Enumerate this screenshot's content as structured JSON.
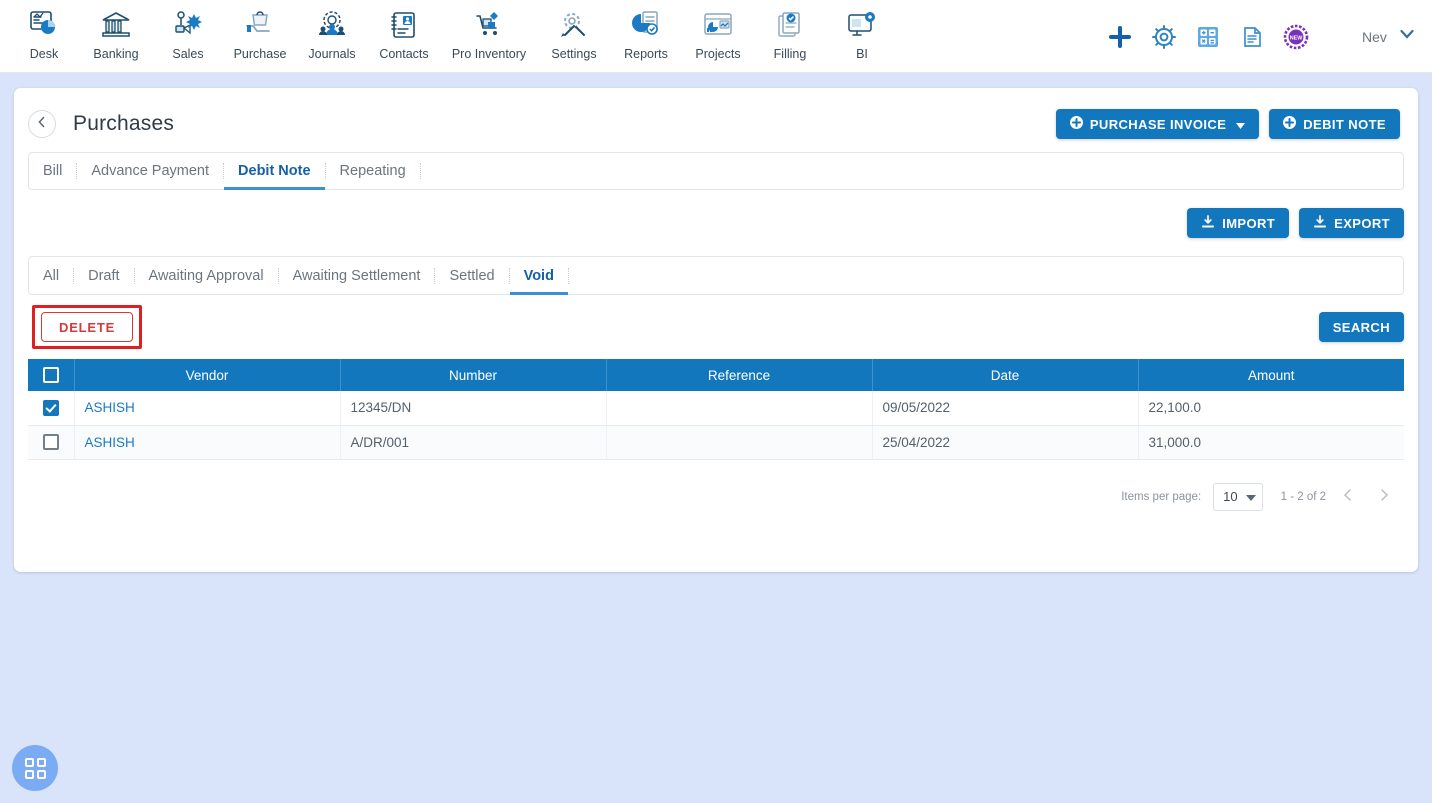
{
  "topnav": {
    "modules": [
      {
        "label": "Desk",
        "icon": "dashboard-icon"
      },
      {
        "label": "Banking",
        "icon": "bank-icon"
      },
      {
        "label": "Sales",
        "icon": "sales-icon"
      },
      {
        "label": "Purchase",
        "icon": "purchase-icon"
      },
      {
        "label": "Journals",
        "icon": "journals-icon"
      },
      {
        "label": "Contacts",
        "icon": "contacts-icon"
      },
      {
        "label": "Pro Inventory",
        "icon": "inventory-icon"
      },
      {
        "label": "Settings",
        "icon": "settings-icon"
      },
      {
        "label": "Reports",
        "icon": "reports-icon"
      },
      {
        "label": "Projects",
        "icon": "projects-icon"
      },
      {
        "label": "Filling",
        "icon": "filling-icon"
      },
      {
        "label": "BI",
        "icon": "bi-icon"
      }
    ],
    "actions": [
      {
        "icon": "plus-icon"
      },
      {
        "icon": "gear-icon"
      },
      {
        "icon": "calculator-icon"
      },
      {
        "icon": "notes-icon"
      },
      {
        "icon": "new-badge-icon"
      }
    ],
    "user": {
      "name": "Nev",
      "chevron": "chevron-down-icon"
    }
  },
  "page": {
    "title": "Purchases",
    "back_icon": "chevron-left-icon"
  },
  "header_buttons": {
    "purchase_invoice": "PURCHASE INVOICE",
    "debit_note": "DEBIT NOTE"
  },
  "doc_tabs": [
    {
      "label": "Bill",
      "active": false
    },
    {
      "label": "Advance Payment",
      "active": false
    },
    {
      "label": "Debit Note",
      "active": true
    },
    {
      "label": "Repeating",
      "active": false
    }
  ],
  "io_buttons": {
    "import": "IMPORT",
    "export": "EXPORT"
  },
  "status_tabs": [
    {
      "label": "All",
      "active": false
    },
    {
      "label": "Draft",
      "active": false
    },
    {
      "label": "Awaiting Approval",
      "active": false
    },
    {
      "label": "Awaiting Settlement",
      "active": false
    },
    {
      "label": "Settled",
      "active": false
    },
    {
      "label": "Void",
      "active": true
    }
  ],
  "actions": {
    "delete": "DELETE",
    "search": "SEARCH"
  },
  "table": {
    "columns": [
      "Vendor",
      "Number",
      "Reference",
      "Date",
      "Amount"
    ],
    "header_checkbox": "unchecked",
    "rows": [
      {
        "checked": true,
        "vendor": "ASHISH",
        "number": "12345/DN",
        "reference": "",
        "date": "09/05/2022",
        "amount": "22,100.0"
      },
      {
        "checked": false,
        "vendor": "ASHISH",
        "number": "A/DR/001",
        "reference": "",
        "date": "25/04/2022",
        "amount": "31,000.0"
      }
    ]
  },
  "paginator": {
    "items_per_page_label": "Items per page:",
    "items_per_page_value": "10",
    "range_label": "1 - 2 of 2",
    "prev_icon": "chevron-left-icon",
    "next_icon": "chevron-right-icon"
  },
  "fab": {
    "icon": "apps-grid-icon"
  },
  "colors": {
    "brand_blue": "#1277bc",
    "page_background": "#d9e4fb",
    "danger_red": "#d33a3a",
    "annotation_red": "#e02020",
    "link_blue": "#1b7ac4",
    "active_tab_blue": "#1560a8"
  }
}
